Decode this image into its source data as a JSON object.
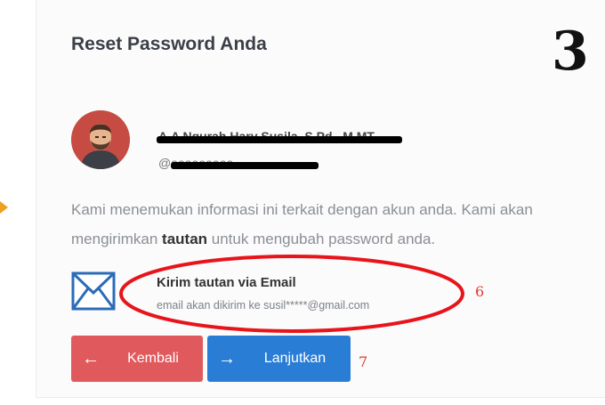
{
  "page": {
    "title": "Reset Password Anda",
    "step_number": "3"
  },
  "user": {
    "name": "A.A Ngurah Hary Susila, S.Pd., M.MT",
    "handle": "@aaaaaaaaa"
  },
  "description": {
    "part1": "Kami menemukan informasi ini terkait dengan akun anda. Kami akan mengirimkan ",
    "bold": "tautan",
    "part2": " untuk mengubah password anda."
  },
  "option": {
    "icon": "envelope-icon",
    "title": "Kirim tautan via Email",
    "subtitle": "email akan dikirim ke susil*****@gmail.com"
  },
  "buttons": {
    "back_label": "Kembali",
    "back_icon": "←",
    "next_label": "Lanjutkan",
    "next_icon": "→"
  },
  "annotations": {
    "six": "6",
    "seven": "7"
  },
  "colors": {
    "back_button": "#e05a5d",
    "next_button": "#2a7dd5",
    "annotation_red": "#e23a2e",
    "envelope_blue": "#2b6cb8"
  }
}
